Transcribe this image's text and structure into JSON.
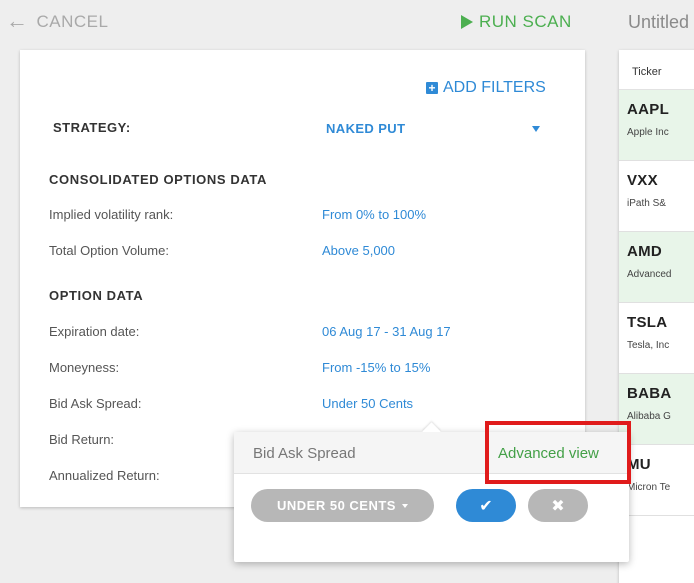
{
  "topbar": {
    "cancel_label": "CANCEL",
    "run_scan_label": "RUN SCAN",
    "title": "Untitled"
  },
  "filters": {
    "add_filters_label": "ADD FILTERS",
    "strategy_label": "STRATEGY:",
    "strategy_value": "NAKED PUT",
    "section_consolidated": "CONSOLIDATED OPTIONS DATA",
    "section_option": "OPTION DATA",
    "rows": [
      {
        "label": "Implied volatility rank:",
        "value": "From 0% to 100%"
      },
      {
        "label": "Total Option Volume:",
        "value": "Above 5,000"
      },
      {
        "label": "Expiration date:",
        "value": "06 Aug 17 - 31 Aug 17"
      },
      {
        "label": "Moneyness:",
        "value": "From -15% to 15%"
      },
      {
        "label": "Bid Ask Spread:",
        "value": "Under 50 Cents"
      },
      {
        "label": "Bid Return:",
        "value": ""
      },
      {
        "label": "Annualized Return:",
        "value": ""
      }
    ]
  },
  "results": {
    "column_header": "Ticker",
    "tickers": [
      {
        "symbol": "AAPL",
        "name": "Apple Inc"
      },
      {
        "symbol": "VXX",
        "name": "iPath S&"
      },
      {
        "symbol": "AMD",
        "name": "Advanced"
      },
      {
        "symbol": "TSLA",
        "name": "Tesla, Inc"
      },
      {
        "symbol": "BABA",
        "name": "Alibaba G"
      },
      {
        "symbol": "MU",
        "name": "Micron Te"
      }
    ]
  },
  "popover": {
    "title": "Bid Ask Spread",
    "advanced_view_label": "Advanced view",
    "dropdown_value": "UNDER 50 CENTS",
    "confirm_icon": "✔",
    "cancel_icon": "✖"
  },
  "colors": {
    "accent_blue": "#2f8ad6",
    "accent_green": "#4caf50",
    "highlight_red": "#e01b1b"
  }
}
